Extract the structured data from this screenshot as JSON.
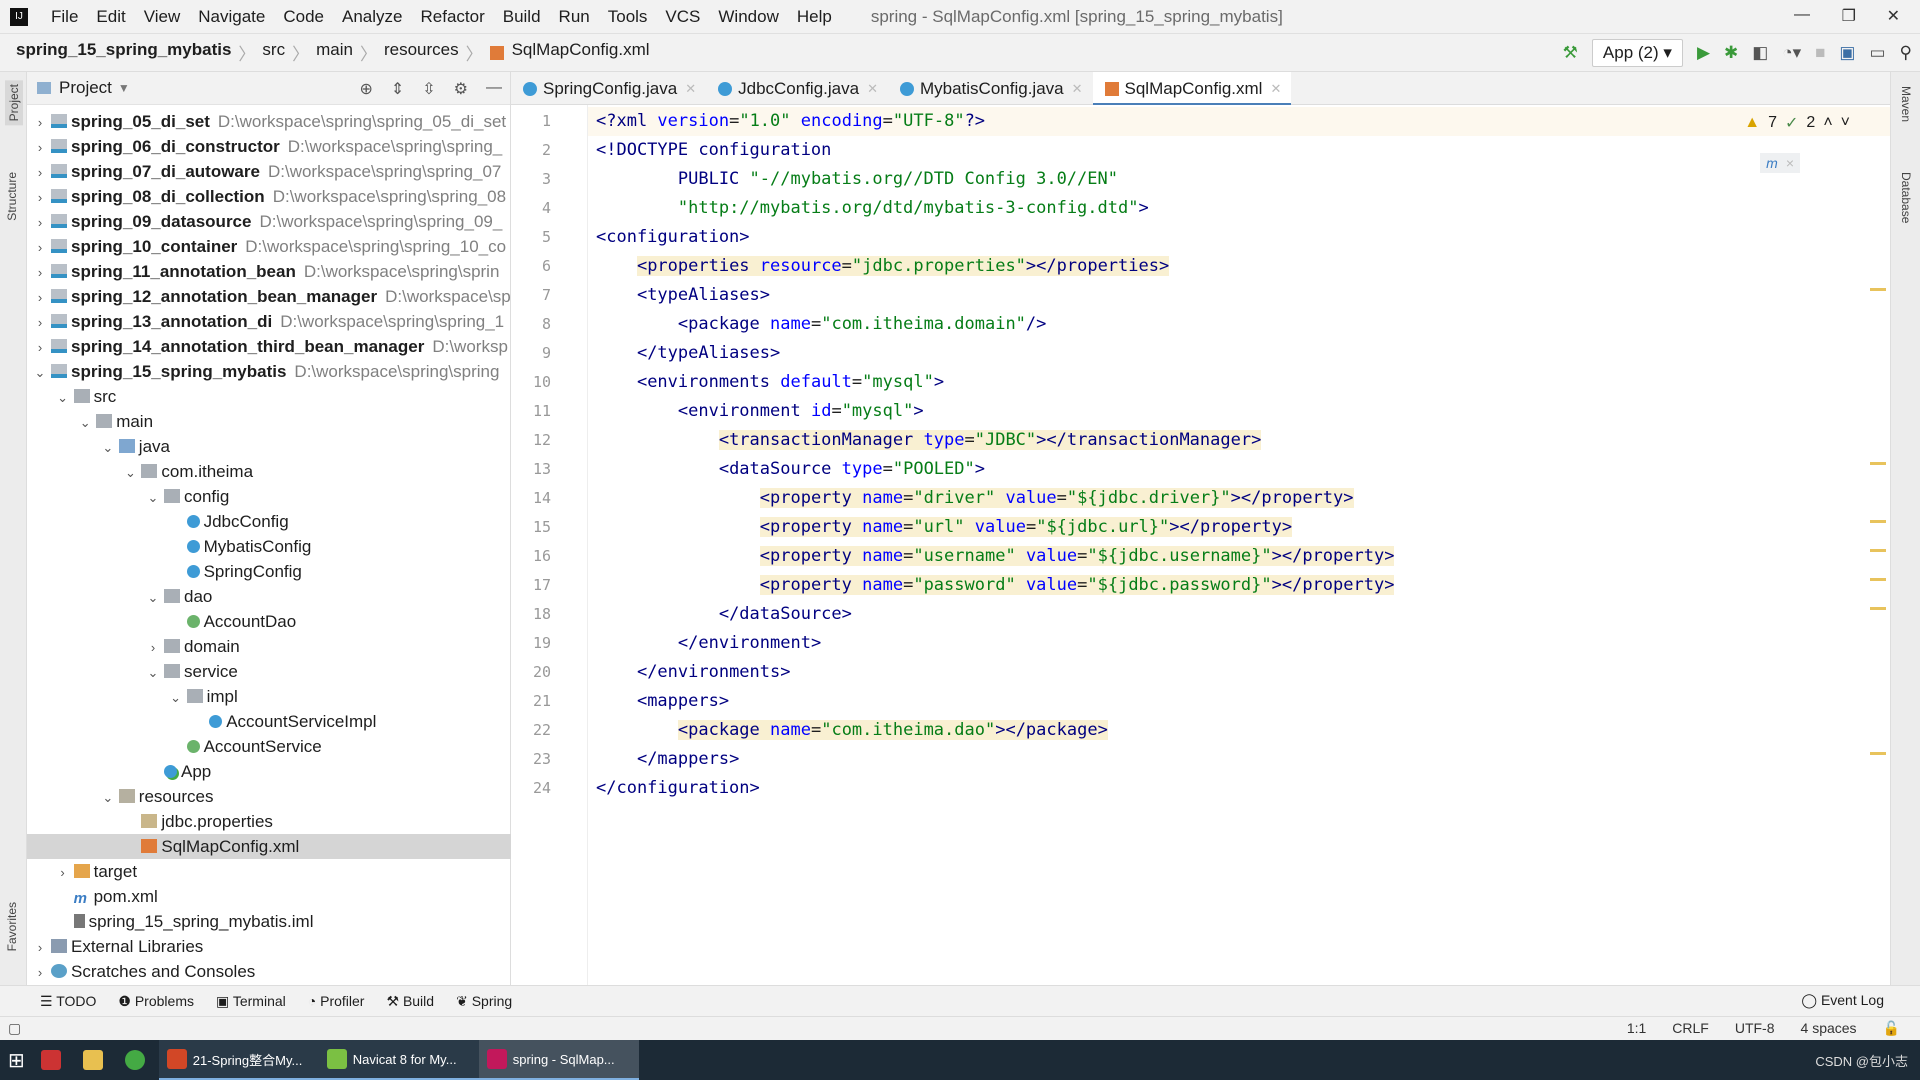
{
  "window": {
    "title": "spring - SqlMapConfig.xml [spring_15_spring_mybatis]"
  },
  "menu": [
    "File",
    "Edit",
    "View",
    "Navigate",
    "Code",
    "Analyze",
    "Refactor",
    "Build",
    "Run",
    "Tools",
    "VCS",
    "Window",
    "Help"
  ],
  "breadcrumb": [
    "spring_15_spring_mybatis",
    "src",
    "main",
    "resources",
    "SqlMapConfig.xml"
  ],
  "toolbar": {
    "run_config": "App (2)"
  },
  "left_stripe": [
    "Project",
    "Structure",
    "Favorites"
  ],
  "right_stripe": [
    "Maven",
    "Database"
  ],
  "project_panel": {
    "title": "Project",
    "items": [
      {
        "level": 0,
        "arrow": "right",
        "icon": "module",
        "name": "spring_05_di_set",
        "bold": true,
        "path": "D:\\workspace\\spring\\spring_05_di_set"
      },
      {
        "level": 0,
        "arrow": "right",
        "icon": "module",
        "name": "spring_06_di_constructor",
        "bold": true,
        "path": "D:\\workspace\\spring\\spring_"
      },
      {
        "level": 0,
        "arrow": "right",
        "icon": "module",
        "name": "spring_07_di_autoware",
        "bold": true,
        "path": "D:\\workspace\\spring\\spring_07"
      },
      {
        "level": 0,
        "arrow": "right",
        "icon": "module",
        "name": "spring_08_di_collection",
        "bold": true,
        "path": "D:\\workspace\\spring\\spring_08"
      },
      {
        "level": 0,
        "arrow": "right",
        "icon": "module",
        "name": "spring_09_datasource",
        "bold": true,
        "path": "D:\\workspace\\spring\\spring_09_"
      },
      {
        "level": 0,
        "arrow": "right",
        "icon": "module",
        "name": "spring_10_container",
        "bold": true,
        "path": "D:\\workspace\\spring\\spring_10_co"
      },
      {
        "level": 0,
        "arrow": "right",
        "icon": "module",
        "name": "spring_11_annotation_bean",
        "bold": true,
        "path": "D:\\workspace\\spring\\sprin"
      },
      {
        "level": 0,
        "arrow": "right",
        "icon": "module",
        "name": "spring_12_annotation_bean_manager",
        "bold": true,
        "path": "D:\\workspace\\sp"
      },
      {
        "level": 0,
        "arrow": "right",
        "icon": "module",
        "name": "spring_13_annotation_di",
        "bold": true,
        "path": "D:\\workspace\\spring\\spring_1"
      },
      {
        "level": 0,
        "arrow": "right",
        "icon": "module",
        "name": "spring_14_annotation_third_bean_manager",
        "bold": true,
        "path": "D:\\worksp"
      },
      {
        "level": 0,
        "arrow": "down",
        "icon": "module",
        "name": "spring_15_spring_mybatis",
        "bold": true,
        "path": "D:\\workspace\\spring\\spring"
      },
      {
        "level": 1,
        "arrow": "down",
        "icon": "folder",
        "name": "src"
      },
      {
        "level": 2,
        "arrow": "down",
        "icon": "folder",
        "name": "main"
      },
      {
        "level": 3,
        "arrow": "down",
        "icon": "srcfolder",
        "name": "java"
      },
      {
        "level": 4,
        "arrow": "down",
        "icon": "folder",
        "name": "com.itheima"
      },
      {
        "level": 5,
        "arrow": "down",
        "icon": "folder",
        "name": "config"
      },
      {
        "level": 6,
        "arrow": "",
        "icon": "class",
        "name": "JdbcConfig"
      },
      {
        "level": 6,
        "arrow": "",
        "icon": "class",
        "name": "MybatisConfig"
      },
      {
        "level": 6,
        "arrow": "",
        "icon": "class",
        "name": "SpringConfig"
      },
      {
        "level": 5,
        "arrow": "down",
        "icon": "folder",
        "name": "dao"
      },
      {
        "level": 6,
        "arrow": "",
        "icon": "iface",
        "name": "AccountDao"
      },
      {
        "level": 5,
        "arrow": "right",
        "icon": "folder",
        "name": "domain"
      },
      {
        "level": 5,
        "arrow": "down",
        "icon": "folder",
        "name": "service"
      },
      {
        "level": 6,
        "arrow": "down",
        "icon": "folder",
        "name": "impl"
      },
      {
        "level": 7,
        "arrow": "",
        "icon": "class",
        "name": "AccountServiceImpl"
      },
      {
        "level": 6,
        "arrow": "",
        "icon": "iface",
        "name": "AccountService"
      },
      {
        "level": 5,
        "arrow": "",
        "icon": "app",
        "name": "App"
      },
      {
        "level": 3,
        "arrow": "down",
        "icon": "resfolder",
        "name": "resources"
      },
      {
        "level": 4,
        "arrow": "",
        "icon": "props",
        "name": "jdbc.properties"
      },
      {
        "level": 4,
        "arrow": "",
        "icon": "xml",
        "name": "SqlMapConfig.xml",
        "selected": true
      },
      {
        "level": 1,
        "arrow": "right",
        "icon": "target",
        "name": "target"
      },
      {
        "level": 1,
        "arrow": "",
        "icon": "maven",
        "name": "pom.xml"
      },
      {
        "level": 1,
        "arrow": "",
        "icon": "iml",
        "name": "spring_15_spring_mybatis.iml"
      },
      {
        "level": 0,
        "arrow": "right",
        "icon": "lib",
        "name": "External Libraries"
      },
      {
        "level": 0,
        "arrow": "right",
        "icon": "scratch",
        "name": "Scratches and Consoles"
      }
    ]
  },
  "tabs": [
    {
      "label": "SpringConfig.java",
      "icon": "class"
    },
    {
      "label": "JdbcConfig.java",
      "icon": "class"
    },
    {
      "label": "MybatisConfig.java",
      "icon": "class"
    },
    {
      "label": "SqlMapConfig.xml",
      "icon": "xml",
      "active": true
    }
  ],
  "inspection": {
    "warnings": "7",
    "typos": "2"
  },
  "code": [
    {
      "hl": false,
      "seg": [
        [
          "tag",
          "<?xml "
        ],
        [
          "attr",
          "version"
        ],
        [
          "plain",
          "="
        ],
        [
          "val",
          "\"1.0\""
        ],
        [
          "plain",
          " "
        ],
        [
          "attr",
          "encoding"
        ],
        [
          "plain",
          "="
        ],
        [
          "val",
          "\"UTF-8\""
        ],
        [
          "tag",
          "?>"
        ]
      ]
    },
    {
      "seg": [
        [
          "doc",
          "<!DOCTYPE configuration"
        ]
      ]
    },
    {
      "seg": [
        [
          "doc",
          "        PUBLIC "
        ],
        [
          "val",
          "\"-//mybatis.org//DTD Config 3.0//EN\""
        ]
      ]
    },
    {
      "seg": [
        [
          "plain",
          "        "
        ],
        [
          "val",
          "\"http://mybatis.org/dtd/mybatis-3-config.dtd\""
        ],
        [
          "doc",
          ">"
        ]
      ]
    },
    {
      "seg": [
        [
          "tag",
          "<configuration>"
        ]
      ]
    },
    {
      "indent": "    ",
      "hl": true,
      "seg": [
        [
          "tag",
          "<properties "
        ],
        [
          "attr",
          "resource"
        ],
        [
          "plain",
          "="
        ],
        [
          "val",
          "\"jdbc.properties\""
        ],
        [
          "tag",
          "></properties>"
        ]
      ]
    },
    {
      "indent": "    ",
      "seg": [
        [
          "tag",
          "<typeAliases>"
        ]
      ]
    },
    {
      "indent": "        ",
      "seg": [
        [
          "tag",
          "<package "
        ],
        [
          "attr",
          "name"
        ],
        [
          "plain",
          "="
        ],
        [
          "val",
          "\"com.itheima.domain\""
        ],
        [
          "tag",
          "/>"
        ]
      ]
    },
    {
      "indent": "    ",
      "seg": [
        [
          "tag",
          "</typeAliases>"
        ]
      ]
    },
    {
      "indent": "    ",
      "seg": [
        [
          "tag",
          "<environments "
        ],
        [
          "attr",
          "default"
        ],
        [
          "plain",
          "="
        ],
        [
          "val",
          "\"mysql\""
        ],
        [
          "tag",
          ">"
        ]
      ]
    },
    {
      "indent": "        ",
      "seg": [
        [
          "tag",
          "<environment "
        ],
        [
          "attr",
          "id"
        ],
        [
          "plain",
          "="
        ],
        [
          "val",
          "\"mysql\""
        ],
        [
          "tag",
          ">"
        ]
      ]
    },
    {
      "indent": "            ",
      "hl": true,
      "seg": [
        [
          "tag",
          "<transactionManager "
        ],
        [
          "attr",
          "type"
        ],
        [
          "plain",
          "="
        ],
        [
          "val",
          "\"JDBC\""
        ],
        [
          "tag",
          "></transactionManager>"
        ]
      ]
    },
    {
      "indent": "            ",
      "seg": [
        [
          "tag",
          "<dataSource "
        ],
        [
          "attr",
          "type"
        ],
        [
          "plain",
          "="
        ],
        [
          "val",
          "\"POOLED\""
        ],
        [
          "tag",
          ">"
        ]
      ]
    },
    {
      "indent": "                ",
      "hl": true,
      "seg": [
        [
          "tag",
          "<property "
        ],
        [
          "attr",
          "name"
        ],
        [
          "plain",
          "="
        ],
        [
          "val",
          "\"driver\""
        ],
        [
          "plain",
          " "
        ],
        [
          "attr",
          "value"
        ],
        [
          "plain",
          "="
        ],
        [
          "val",
          "\"${jdbc.driver}\""
        ],
        [
          "tag",
          "></property>"
        ]
      ]
    },
    {
      "indent": "                ",
      "hl": true,
      "seg": [
        [
          "tag",
          "<property "
        ],
        [
          "attr",
          "name"
        ],
        [
          "plain",
          "="
        ],
        [
          "val",
          "\"url\""
        ],
        [
          "plain",
          " "
        ],
        [
          "attr",
          "value"
        ],
        [
          "plain",
          "="
        ],
        [
          "val",
          "\"${jdbc.url}\""
        ],
        [
          "tag",
          "></property>"
        ]
      ]
    },
    {
      "indent": "                ",
      "hl": true,
      "seg": [
        [
          "tag",
          "<property "
        ],
        [
          "attr",
          "name"
        ],
        [
          "plain",
          "="
        ],
        [
          "val",
          "\"username\""
        ],
        [
          "plain",
          " "
        ],
        [
          "attr",
          "value"
        ],
        [
          "plain",
          "="
        ],
        [
          "val",
          "\"${jdbc.username}\""
        ],
        [
          "tag",
          "></property>"
        ]
      ]
    },
    {
      "indent": "                ",
      "hl": true,
      "seg": [
        [
          "tag",
          "<property "
        ],
        [
          "attr",
          "name"
        ],
        [
          "plain",
          "="
        ],
        [
          "val",
          "\"password\""
        ],
        [
          "plain",
          " "
        ],
        [
          "attr",
          "value"
        ],
        [
          "plain",
          "="
        ],
        [
          "val",
          "\"${jdbc.password}\""
        ],
        [
          "tag",
          "></property>"
        ]
      ]
    },
    {
      "indent": "            ",
      "seg": [
        [
          "tag",
          "</dataSource>"
        ]
      ]
    },
    {
      "indent": "        ",
      "seg": [
        [
          "tag",
          "</environment>"
        ]
      ]
    },
    {
      "indent": "    ",
      "seg": [
        [
          "tag",
          "</environments>"
        ]
      ]
    },
    {
      "indent": "    ",
      "seg": [
        [
          "tag",
          "<mappers>"
        ]
      ]
    },
    {
      "indent": "        ",
      "hl": true,
      "seg": [
        [
          "tag",
          "<package "
        ],
        [
          "attr",
          "name"
        ],
        [
          "plain",
          "="
        ],
        [
          "val",
          "\"com.itheima.dao\""
        ],
        [
          "tag",
          "></package>"
        ]
      ]
    },
    {
      "indent": "    ",
      "seg": [
        [
          "tag",
          "</mappers>"
        ]
      ]
    },
    {
      "seg": [
        [
          "tag",
          "</configuration>"
        ]
      ]
    }
  ],
  "bottom_tools": [
    "TODO",
    "Problems",
    "Terminal",
    "Profiler",
    "Build",
    "Spring"
  ],
  "event_log": "Event Log",
  "status": {
    "position": "1:1",
    "line_sep": "CRLF",
    "encoding": "UTF-8",
    "indent": "4 spaces"
  },
  "taskbar": {
    "apps": [
      "21-Spring整合My...",
      "Navicat 8 for My...",
      "spring - SqlMap..."
    ],
    "tray": "CSDN @包小志"
  },
  "colors": {
    "tag": "#000080",
    "attr": "#0000ff",
    "value": "#067d17",
    "highlight": "#f9f0d2",
    "accent": "#4a7fb8"
  }
}
